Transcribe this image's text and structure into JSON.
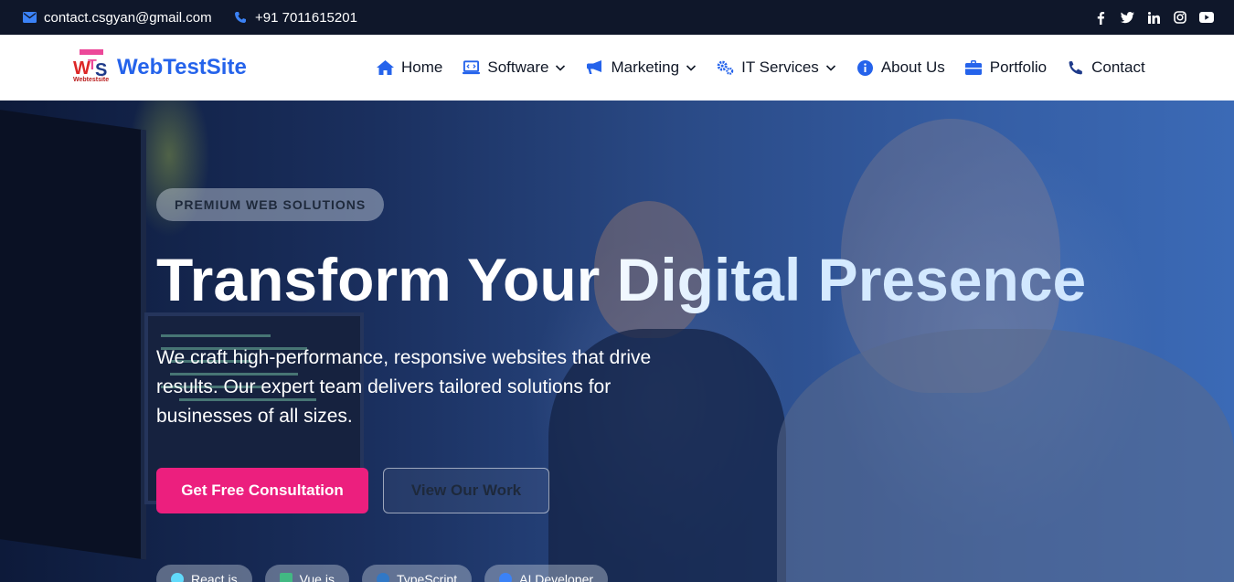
{
  "topbar": {
    "email": "contact.csgyan@gmail.com",
    "phone": "+91 7011615201",
    "social": [
      "facebook-icon",
      "twitter-icon",
      "linkedin-icon",
      "instagram-icon",
      "youtube-icon"
    ]
  },
  "brand": {
    "logo_text": "WebTestSite",
    "logo_caption": "Webtestsite"
  },
  "nav": {
    "items": [
      {
        "label": "Home",
        "icon": "home-icon",
        "dropdown": false
      },
      {
        "label": "Software",
        "icon": "laptop-code-icon",
        "dropdown": true
      },
      {
        "label": "Marketing",
        "icon": "megaphone-icon",
        "dropdown": true
      },
      {
        "label": "IT Services",
        "icon": "gears-icon",
        "dropdown": true
      },
      {
        "label": "About Us",
        "icon": "info-circle-icon",
        "dropdown": false
      },
      {
        "label": "Portfolio",
        "icon": "briefcase-icon",
        "dropdown": false
      },
      {
        "label": "Contact",
        "icon": "phone-icon",
        "dropdown": false
      }
    ]
  },
  "hero": {
    "badge": "PREMIUM WEB SOLUTIONS",
    "title": "Transform Your Digital Presence",
    "description": "We craft high-performance, responsive websites that drive results. Our expert team delivers tailored solutions for businesses of all sizes.",
    "primary_cta": "Get Free Consultation",
    "secondary_cta": "View Our Work",
    "tags": [
      {
        "label": "React.js",
        "color": "#61dafb"
      },
      {
        "label": "Vue.js",
        "color": "#42b883"
      },
      {
        "label": "TypeScript",
        "color": "#3178c6"
      },
      {
        "label": "AI Developer",
        "color": "#3b82f6"
      }
    ]
  },
  "colors": {
    "accent": "#2563eb",
    "cta": "#ec1f7e",
    "topbar_bg": "#0f172a"
  }
}
